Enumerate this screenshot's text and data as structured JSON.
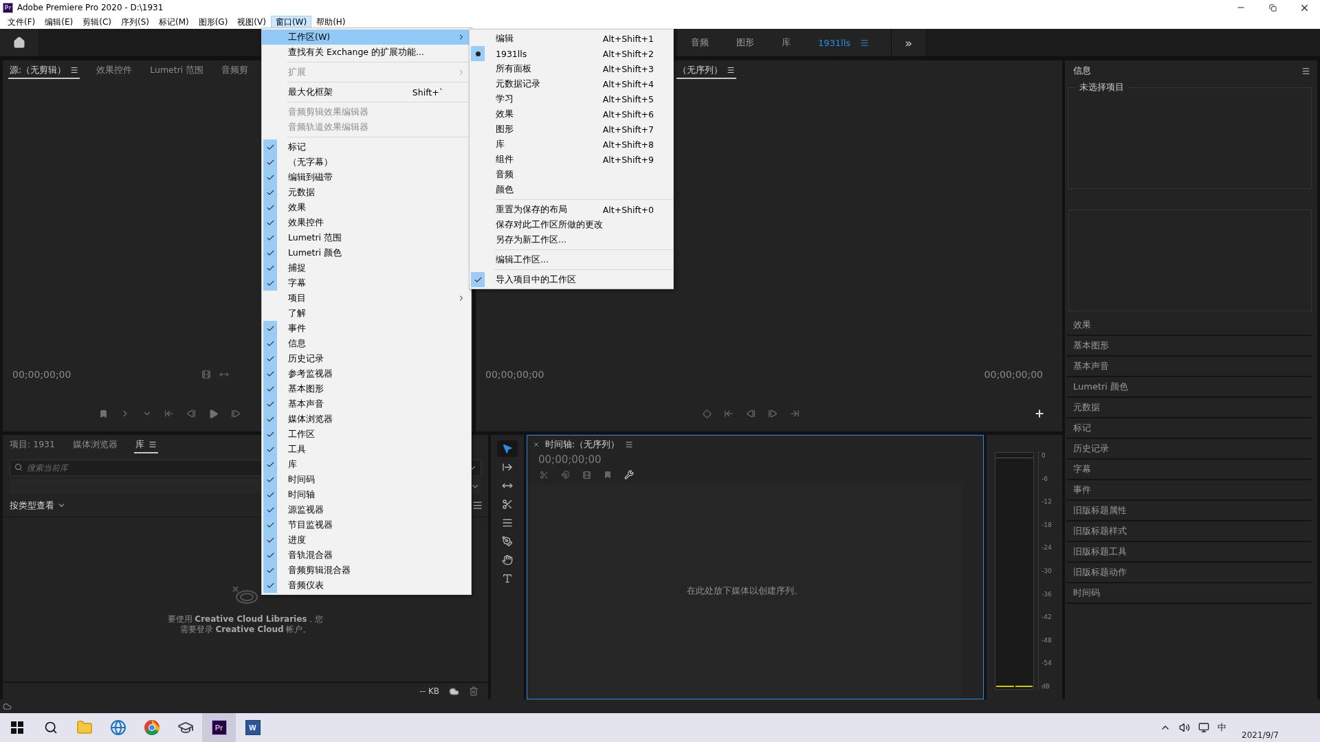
{
  "window": {
    "app_icon": "Pr",
    "title": "Adobe Premiere Pro 2020 - D:\\1931"
  },
  "menu_bar": [
    {
      "label": "文件(F)",
      "selected": false
    },
    {
      "label": "编辑(E)",
      "selected": false
    },
    {
      "label": "剪辑(C)",
      "selected": false
    },
    {
      "label": "序列(S)",
      "selected": false
    },
    {
      "label": "标记(M)",
      "selected": false
    },
    {
      "label": "图形(G)",
      "selected": false
    },
    {
      "label": "视图(V)",
      "selected": false
    },
    {
      "label": "窗口(W)",
      "selected": true
    },
    {
      "label": "帮助(H)",
      "selected": false
    }
  ],
  "workspaces": {
    "tabs": [
      {
        "label": "音频",
        "selected": false
      },
      {
        "label": "图形",
        "selected": false
      },
      {
        "label": "库",
        "selected": false
      },
      {
        "label": "1931lls",
        "selected": true
      }
    ],
    "more": "»"
  },
  "source_monitor": {
    "tabs": [
      {
        "label": "源:（无剪辑）",
        "selected": true
      },
      {
        "label": "效果控件",
        "selected": false
      },
      {
        "label": "Lumetri 范围",
        "selected": false
      },
      {
        "label": "音频剪",
        "selected": false
      }
    ],
    "timecode": "00;00;00;00"
  },
  "program_monitor": {
    "tabs": [
      {
        "label": "（无序列）",
        "selected": true
      }
    ],
    "timecode_left": "00;00;00;00",
    "timecode_right": "00;00;00;00"
  },
  "project_panel": {
    "tabs": [
      {
        "label": "项目: 1931",
        "selected": false
      },
      {
        "label": "媒体浏览器",
        "selected": false
      },
      {
        "label": "库",
        "selected": true
      }
    ],
    "search": {
      "placeholder": "搜索当前库"
    },
    "view_by": "按类型查看",
    "message": [
      "要使用 **Creative Cloud Libraries**，您",
      "需要登录 **Creative Cloud** 帐户。"
    ],
    "storage": "-- KB"
  },
  "tools": [
    {
      "kind": "selection",
      "selected": true
    },
    {
      "kind": "track-select",
      "selected": false
    },
    {
      "kind": "ripple",
      "selected": false
    },
    {
      "kind": "razor",
      "selected": false
    },
    {
      "kind": "slip",
      "selected": false
    },
    {
      "kind": "pen",
      "selected": false
    },
    {
      "kind": "hand",
      "selected": false
    },
    {
      "kind": "type",
      "selected": false
    }
  ],
  "timeline": {
    "title": "时间轴:（无序列）",
    "timecode": "00;00;00;00",
    "empty_message": "在此处放下媒体以创建序列。"
  },
  "audio_meter": {
    "scale": [
      "0",
      "-6",
      "-12",
      "-18",
      "-24",
      "-30",
      "-36",
      "-42",
      "-48",
      "-54",
      "dB"
    ]
  },
  "info_panel": {
    "title": "信息",
    "legend": "未选择项目",
    "panels": [
      "效果",
      "基本图形",
      "基本声音",
      "Lumetri 颜色",
      "元数据",
      "标记",
      "历史记录",
      "字幕",
      "事件",
      "旧版标题属性",
      "旧版标题样式",
      "旧版标题工具",
      "旧版标题动作",
      "时间码"
    ]
  },
  "window_menu": {
    "items": [
      {
        "kind": "item",
        "label": "工作区(W)",
        "selected": true,
        "checked": false,
        "disabled": false,
        "submenu": true
      },
      {
        "kind": "item",
        "label": "查找有关 Exchange 的扩展功能...",
        "selected": false,
        "checked": false,
        "disabled": false,
        "submenu": false
      },
      {
        "kind": "separator"
      },
      {
        "kind": "item",
        "label": "扩展",
        "selected": false,
        "checked": false,
        "disabled": true,
        "submenu": true
      },
      {
        "kind": "separator"
      },
      {
        "kind": "item",
        "label": "最大化框架",
        "shortcut": "Shift+`",
        "selected": false,
        "checked": false,
        "disabled": false,
        "submenu": false
      },
      {
        "kind": "separator"
      },
      {
        "kind": "item",
        "label": "音频剪辑效果编辑器",
        "selected": false,
        "checked": false,
        "disabled": true,
        "submenu": false
      },
      {
        "kind": "item",
        "label": "音频轨道效果编辑器",
        "selected": false,
        "checked": false,
        "disabled": true,
        "submenu": false
      },
      {
        "kind": "separator"
      },
      {
        "kind": "item",
        "label": "标记",
        "selected": false,
        "checked": true,
        "disabled": false,
        "submenu": false
      },
      {
        "kind": "item",
        "label": "（无字幕）",
        "selected": false,
        "checked": true,
        "disabled": false,
        "submenu": false
      },
      {
        "kind": "item",
        "label": "编辑到磁带",
        "selected": false,
        "checked": true,
        "disabled": false,
        "submenu": false
      },
      {
        "kind": "item",
        "label": "元数据",
        "selected": false,
        "checked": true,
        "disabled": false,
        "submenu": false
      },
      {
        "kind": "item",
        "label": "效果",
        "selected": false,
        "checked": true,
        "disabled": false,
        "submenu": false
      },
      {
        "kind": "item",
        "label": "效果控件",
        "selected": false,
        "checked": true,
        "disabled": false,
        "submenu": false
      },
      {
        "kind": "item",
        "label": "Lumetri 范围",
        "selected": false,
        "checked": true,
        "disabled": false,
        "submenu": false
      },
      {
        "kind": "item",
        "label": "Lumetri 颜色",
        "selected": false,
        "checked": true,
        "disabled": false,
        "submenu": false
      },
      {
        "kind": "item",
        "label": "捕捉",
        "selected": false,
        "checked": true,
        "disabled": false,
        "submenu": false
      },
      {
        "kind": "item",
        "label": "字幕",
        "selected": false,
        "checked": true,
        "disabled": false,
        "submenu": false
      },
      {
        "kind": "item",
        "label": "项目",
        "selected": false,
        "checked": false,
        "disabled": false,
        "submenu": true
      },
      {
        "kind": "item",
        "label": "了解",
        "selected": false,
        "checked": false,
        "disabled": false,
        "submenu": false
      },
      {
        "kind": "item",
        "label": "事件",
        "selected": false,
        "checked": true,
        "disabled": false,
        "submenu": false
      },
      {
        "kind": "item",
        "label": "信息",
        "selected": false,
        "checked": true,
        "disabled": false,
        "submenu": false
      },
      {
        "kind": "item",
        "label": "历史记录",
        "selected": false,
        "checked": true,
        "disabled": false,
        "submenu": false
      },
      {
        "kind": "item",
        "label": "参考监视器",
        "selected": false,
        "checked": true,
        "disabled": false,
        "submenu": false
      },
      {
        "kind": "item",
        "label": "基本图形",
        "selected": false,
        "checked": true,
        "disabled": false,
        "submenu": false
      },
      {
        "kind": "item",
        "label": "基本声音",
        "selected": false,
        "checked": true,
        "disabled": false,
        "submenu": false
      },
      {
        "kind": "item",
        "label": "媒体浏览器",
        "selected": false,
        "checked": true,
        "disabled": false,
        "submenu": false
      },
      {
        "kind": "item",
        "label": "工作区",
        "selected": false,
        "checked": true,
        "disabled": false,
        "submenu": false
      },
      {
        "kind": "item",
        "label": "工具",
        "selected": false,
        "checked": true,
        "disabled": false,
        "submenu": false
      },
      {
        "kind": "item",
        "label": "库",
        "selected": false,
        "checked": true,
        "disabled": false,
        "submenu": false
      },
      {
        "kind": "item",
        "label": "时间码",
        "selected": false,
        "checked": true,
        "disabled": false,
        "submenu": false
      },
      {
        "kind": "item",
        "label": "时间轴",
        "selected": false,
        "checked": true,
        "disabled": false,
        "submenu": false
      },
      {
        "kind": "item",
        "label": "源监视器",
        "selected": false,
        "checked": true,
        "disabled": false,
        "submenu": false
      },
      {
        "kind": "item",
        "label": "节目监视器",
        "selected": false,
        "checked": true,
        "disabled": false,
        "submenu": false
      },
      {
        "kind": "item",
        "label": "进度",
        "selected": false,
        "checked": true,
        "disabled": false,
        "submenu": false
      },
      {
        "kind": "item",
        "label": "音轨混合器",
        "selected": false,
        "checked": true,
        "disabled": false,
        "submenu": false
      },
      {
        "kind": "item",
        "label": "音频剪辑混合器",
        "selected": false,
        "checked": true,
        "disabled": false,
        "submenu": false
      },
      {
        "kind": "item",
        "label": "音频仪表",
        "selected": false,
        "checked": true,
        "disabled": false,
        "submenu": false
      }
    ]
  },
  "workspace_submenu": {
    "items": [
      {
        "kind": "item",
        "label": "编辑",
        "shortcut": "Alt+Shift+1",
        "selected": false,
        "checked": false
      },
      {
        "kind": "item",
        "label": "1931lls",
        "shortcut": "Alt+Shift+2",
        "selected": true,
        "checked": false
      },
      {
        "kind": "item",
        "label": "所有面板",
        "shortcut": "Alt+Shift+3",
        "selected": false,
        "checked": false
      },
      {
        "kind": "item",
        "label": "元数据记录",
        "shortcut": "Alt+Shift+4",
        "selected": false,
        "checked": false
      },
      {
        "kind": "item",
        "label": "学习",
        "shortcut": "Alt+Shift+5",
        "selected": false,
        "checked": false
      },
      {
        "kind": "item",
        "label": "效果",
        "shortcut": "Alt+Shift+6",
        "selected": false,
        "checked": false
      },
      {
        "kind": "item",
        "label": "图形",
        "shortcut": "Alt+Shift+7",
        "selected": false,
        "checked": false
      },
      {
        "kind": "item",
        "label": "库",
        "shortcut": "Alt+Shift+8",
        "selected": false,
        "checked": false
      },
      {
        "kind": "item",
        "label": "组件",
        "shortcut": "Alt+Shift+9",
        "selected": false,
        "checked": false
      },
      {
        "kind": "item",
        "label": "音频",
        "selected": false,
        "checked": false
      },
      {
        "kind": "item",
        "label": "颜色",
        "selected": false,
        "checked": false
      },
      {
        "kind": "separator"
      },
      {
        "kind": "item",
        "label": "重置为保存的布局",
        "shortcut": "Alt+Shift+0",
        "selected": false,
        "checked": false
      },
      {
        "kind": "item",
        "label": "保存对此工作区所做的更改",
        "selected": false,
        "checked": false
      },
      {
        "kind": "item",
        "label": "另存为新工作区...",
        "selected": false,
        "checked": false
      },
      {
        "kind": "separator"
      },
      {
        "kind": "item",
        "label": "编辑工作区...",
        "selected": false,
        "checked": false
      },
      {
        "kind": "separator"
      },
      {
        "kind": "item",
        "label": "导入项目中的工作区",
        "selected": false,
        "checked": true
      }
    ]
  },
  "taskbar": {
    "apps": [
      {
        "kind": "windows",
        "selected": false
      },
      {
        "kind": "search",
        "selected": false
      },
      {
        "kind": "folder",
        "selected": false
      },
      {
        "kind": "edge",
        "selected": false
      },
      {
        "kind": "chrome",
        "selected": false
      },
      {
        "kind": "cap",
        "selected": false
      },
      {
        "kind": "logo",
        "label": "Pr",
        "selected": true
      },
      {
        "kind": "logo",
        "label": "W",
        "selected": false
      }
    ],
    "ime": "中",
    "date": "2021/9/7"
  }
}
